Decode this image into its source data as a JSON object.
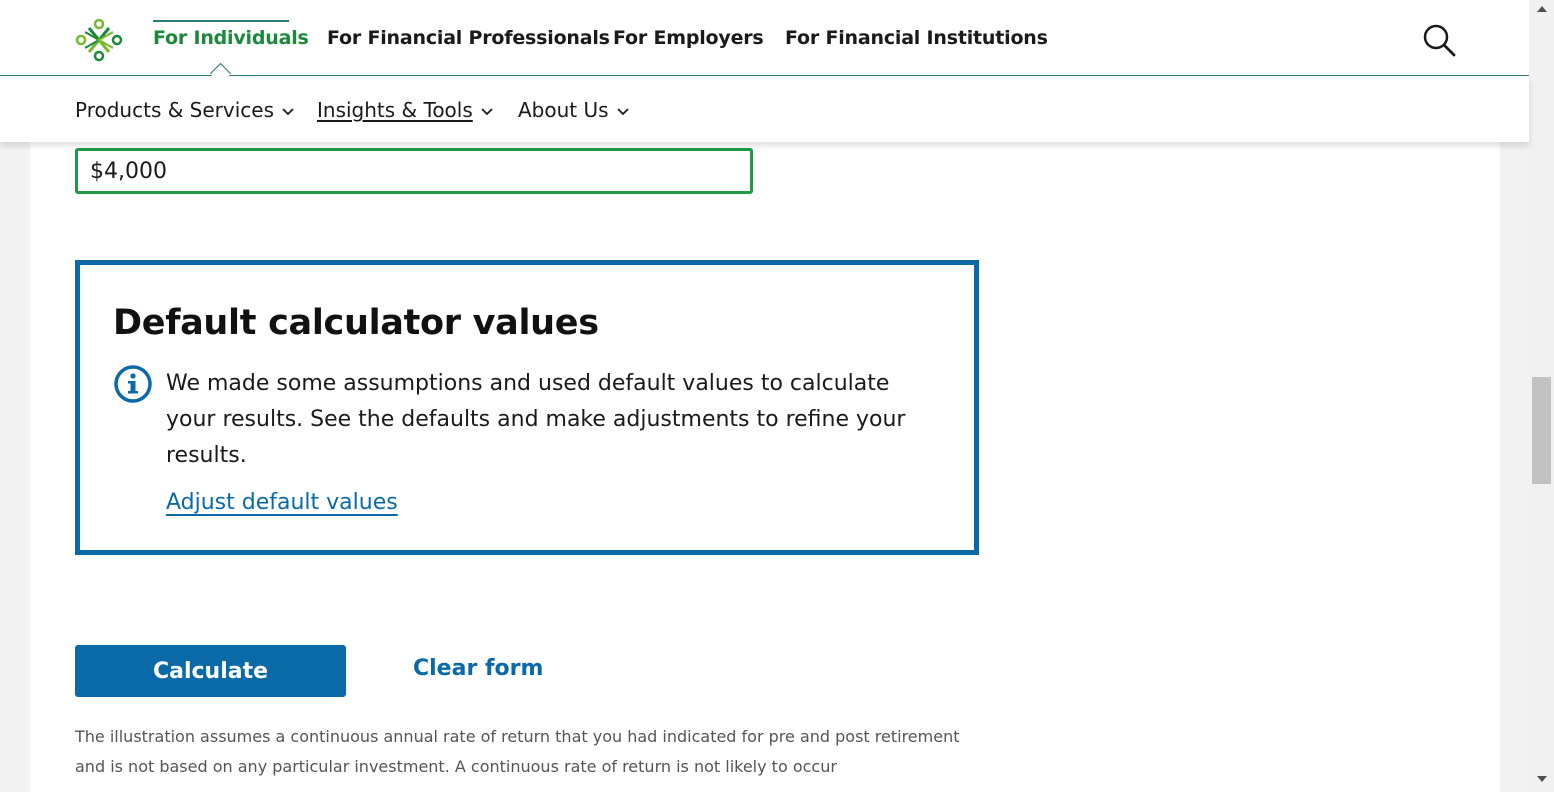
{
  "top_nav": {
    "tabs": [
      {
        "label": "For Individuals",
        "active": true
      },
      {
        "label": "For Financial Professionals",
        "active": false
      },
      {
        "label": "For Employers",
        "active": false
      },
      {
        "label": "For Financial Institutions",
        "active": false
      }
    ],
    "search_icon": "search-icon"
  },
  "sub_nav": {
    "items": [
      {
        "label": "Products & Services"
      },
      {
        "label": "Insights & Tools"
      },
      {
        "label": "About Us"
      }
    ]
  },
  "amount_field": {
    "value": "$4,000"
  },
  "defaults_box": {
    "title": "Default calculator values",
    "icon": "info-icon",
    "text": "We made some assumptions and used default values to calculate your results. See the defaults and make adjustments to refine your results.",
    "link": "Adjust default values"
  },
  "actions": {
    "calculate_label": "Calculate",
    "clear_label": "Clear form"
  },
  "disclaimer": "The illustration assumes a continuous annual rate of return that you had indicated for pre and post retirement and is not based on any particular investment. A continuous rate of return is not likely to occur",
  "colors": {
    "brand_green": "#1a8a3a",
    "accent_blue": "#0a6aa8",
    "input_focus": "#1e9a48"
  }
}
